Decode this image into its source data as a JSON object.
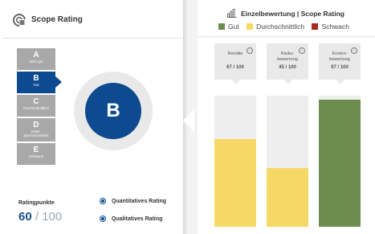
{
  "left": {
    "title": "Scope Rating",
    "grades": [
      {
        "letter": "A",
        "sub": "Sehr gut",
        "active": false
      },
      {
        "letter": "B",
        "sub": "Gut",
        "active": true
      },
      {
        "letter": "C",
        "sub": "Durchschnittlich",
        "active": false
      },
      {
        "letter": "D",
        "sub": "Unter-\ndurchschnittlich",
        "active": false
      },
      {
        "letter": "E",
        "sub": "Schwach",
        "active": false
      }
    ],
    "big_grade": "B",
    "ratingpunkte_label": "Ratingpunkte",
    "ratingpunkte_value": "60",
    "ratingpunkte_sep": " / ",
    "ratingpunkte_max": "100",
    "radio_quantitative": "Quantitatives Rating",
    "radio_qualitative": "Qualitatives Rating",
    "selected_radio": "qualitative"
  },
  "right": {
    "title": "Einzelbewertung | Scope Rating",
    "legend": [
      {
        "label": "Gut",
        "color": "#6b8e4e"
      },
      {
        "label": "Durchschnittlich",
        "color": "#f7d866"
      },
      {
        "label": "Schwach",
        "color": "#a8291f"
      }
    ],
    "cards": [
      {
        "name": "Rendite",
        "value": "67 / 100",
        "fill_fraction": 0.67,
        "color": "#f7d866"
      },
      {
        "name": "Risiko-\nbewertung",
        "value": "45 / 100",
        "fill_fraction": 0.45,
        "color": "#f7d866"
      },
      {
        "name": "Kosten-\nbewertung",
        "value": "97 / 100",
        "fill_fraction": 0.97,
        "color": "#6b8e4e"
      }
    ],
    "info_glyph": "i"
  },
  "colors": {
    "accent_blue": "#0d4a8f",
    "grade_inactive": "#a8a8a8"
  }
}
